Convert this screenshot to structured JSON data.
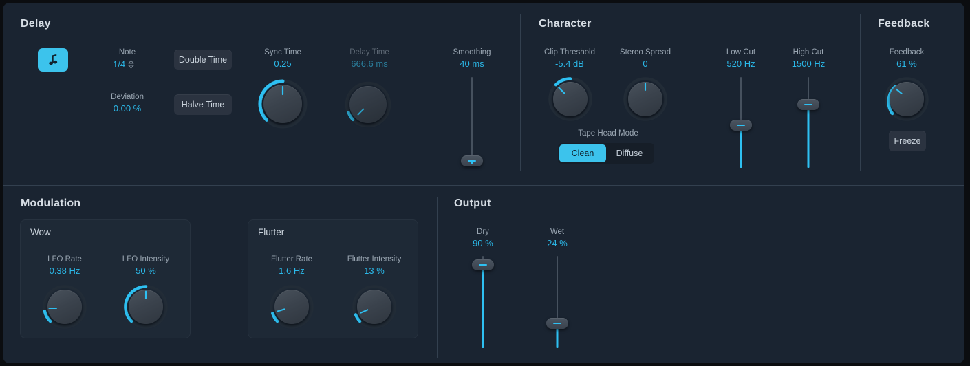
{
  "theme": {
    "accent": "#2ec0f2",
    "accent_button": "#3cc3ec",
    "panel_bg": "#1a2431",
    "label_color": "#9aa6b2",
    "value_color": "#2bb8e8"
  },
  "sections": {
    "delay": {
      "title": "Delay"
    },
    "character": {
      "title": "Character"
    },
    "feedback": {
      "title": "Feedback"
    },
    "modulation": {
      "title": "Modulation"
    },
    "output": {
      "title": "Output"
    }
  },
  "delay": {
    "note_button_icon": "music-note-icon",
    "note": {
      "label": "Note",
      "value": "1/4"
    },
    "deviation": {
      "label": "Deviation",
      "value": "0.00 %"
    },
    "double_time": {
      "label": "Double Time"
    },
    "halve_time": {
      "label": "Halve Time"
    },
    "sync_time": {
      "label": "Sync Time",
      "value": "0.25"
    },
    "delay_time": {
      "label": "Delay Time",
      "value": "666.6 ms"
    },
    "smoothing": {
      "label": "Smoothing",
      "value": "40 ms"
    }
  },
  "character": {
    "clip_threshold": {
      "label": "Clip Threshold",
      "value": "-5.4 dB"
    },
    "stereo_spread": {
      "label": "Stereo Spread",
      "value": "0"
    },
    "tape_head_mode": {
      "label": "Tape Head Mode",
      "options": [
        "Clean",
        "Diffuse"
      ],
      "selected": "Clean"
    },
    "low_cut": {
      "label": "Low Cut",
      "value": "520 Hz"
    },
    "high_cut": {
      "label": "High Cut",
      "value": "1500 Hz"
    }
  },
  "feedback": {
    "amount": {
      "label": "Feedback",
      "value": "61 %"
    },
    "freeze": {
      "label": "Freeze"
    }
  },
  "modulation": {
    "wow": {
      "title": "Wow",
      "lfo_rate": {
        "label": "LFO Rate",
        "value": "0.38 Hz"
      },
      "lfo_intensity": {
        "label": "LFO Intensity",
        "value": "50 %"
      }
    },
    "flutter": {
      "title": "Flutter",
      "flutter_rate": {
        "label": "Flutter Rate",
        "value": "1.6 Hz"
      },
      "flutter_intensity": {
        "label": "Flutter Intensity",
        "value": "13 %"
      }
    }
  },
  "output": {
    "dry": {
      "label": "Dry",
      "value": "90 %"
    },
    "wet": {
      "label": "Wet",
      "value": "24 %"
    }
  }
}
